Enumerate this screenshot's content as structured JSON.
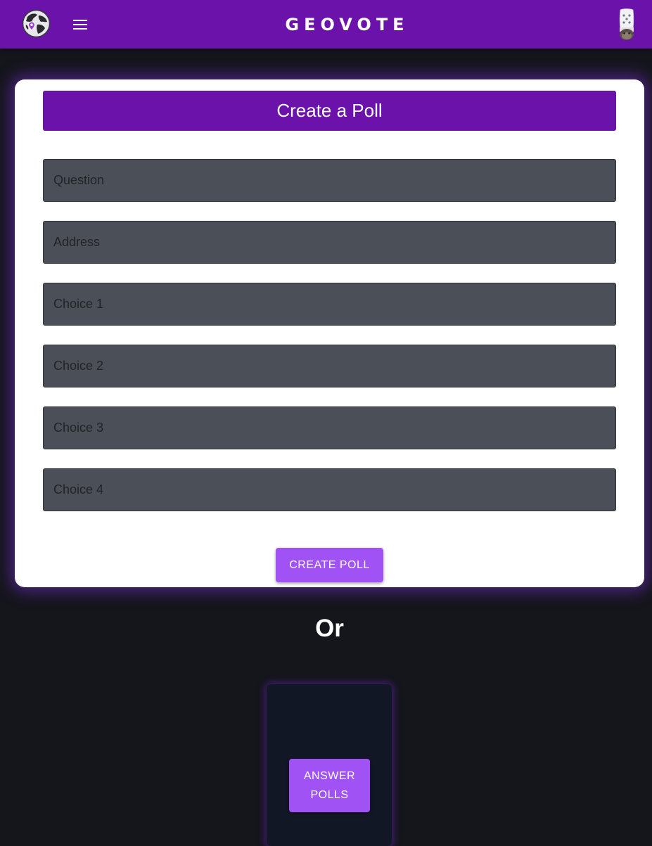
{
  "header": {
    "title": "GEOVOTE",
    "logo_icon": "globe-location-pin-icon",
    "menu_icon": "hamburger-menu-icon",
    "avatar_icon": "user-avatar-icon"
  },
  "create_poll": {
    "heading": "Create a Poll",
    "fields": {
      "question_placeholder": "Question",
      "address_placeholder": "Address",
      "choice1_placeholder": "Choice 1",
      "choice2_placeholder": "Choice 2",
      "choice3_placeholder": "Choice 3",
      "choice4_placeholder": "Choice 4"
    },
    "submit_label": "CREATE POLL"
  },
  "divider_text": "Or",
  "answer": {
    "button_label": "ANSWER POLLS"
  },
  "colors": {
    "brand": "#6a12aa",
    "button": "#a052f4",
    "background": "#15151c",
    "field": "#4b5058",
    "panel": "#121726"
  }
}
